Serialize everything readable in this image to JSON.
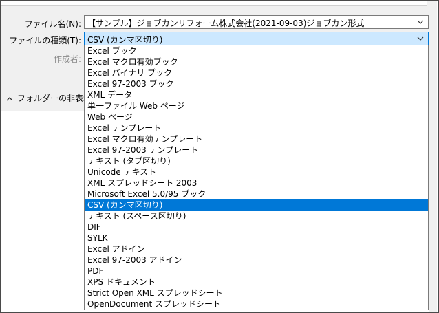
{
  "file_name": {
    "label": "ファイル名(N):",
    "value": "【サンプル】ジョブカンリフォーム株式会社(2021-09-03)ジョブカン形式"
  },
  "file_type": {
    "label": "ファイルの種類(T):",
    "value": "CSV (カンマ区切り)"
  },
  "author": {
    "label": "作成者:"
  },
  "folder_toggle": {
    "label": "フォルダーの非表示",
    "icon": "chevron-up-icon"
  },
  "dropdown": {
    "selected_index": 17,
    "options": [
      "Excel ブック",
      "Excel マクロ有効ブック",
      "Excel バイナリ ブック",
      "Excel 97-2003 ブック",
      "XML データ",
      "単一ファイル Web ページ",
      "Web ページ",
      "Excel テンプレート",
      "Excel マクロ有効テンプレート",
      "Excel 97-2003 テンプレート",
      "テキスト (タブ区切り)",
      "Unicode テキスト",
      "XML スプレッドシート 2003",
      "Microsoft Excel 5.0/95 ブック",
      "CSV (カンマ区切り)",
      "テキスト (スペース区切り)",
      "DIF",
      "SYLK",
      "Excel アドイン",
      "Excel 97-2003 アドイン",
      "PDF",
      "XPS ドキュメント",
      "Strict Open XML スプレッドシート",
      "OpenDocument スプレッドシート"
    ]
  },
  "colors": {
    "selection": "#0078d7",
    "select_field_bg": "#cce8ff",
    "dialog_bg": "#f0f0f0"
  }
}
